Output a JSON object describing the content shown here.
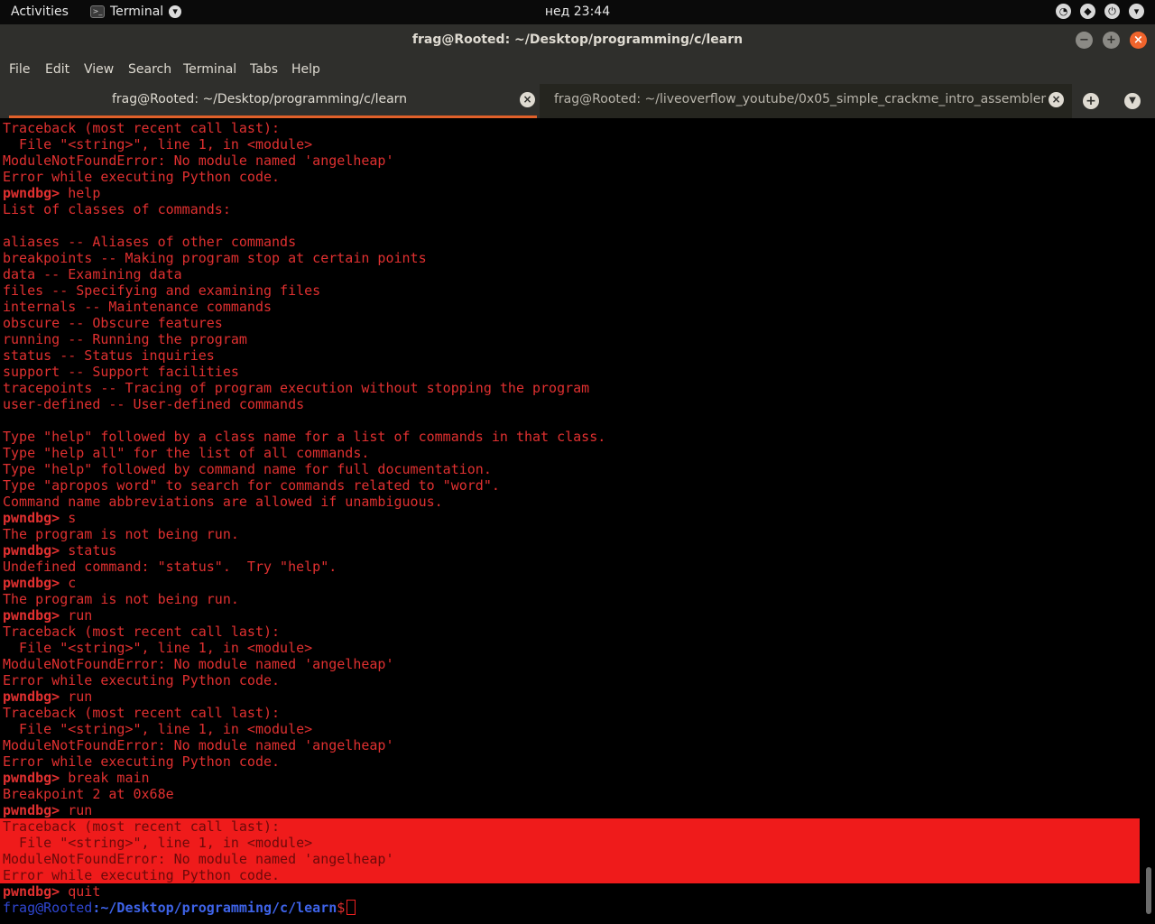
{
  "topbar": {
    "activities": "Activities",
    "app_name": "Terminal",
    "clock": "нед 23:44"
  },
  "window": {
    "title": "frag@Rooted: ~/Desktop/programming/c/learn"
  },
  "menu": [
    "File",
    "Edit",
    "View",
    "Search",
    "Terminal",
    "Tabs",
    "Help"
  ],
  "tabs": [
    {
      "label": "frag@Rooted: ~/Desktop/programming/c/learn"
    },
    {
      "label": "frag@Rooted: ~/liveoverflow_youtube/0x05_simple_crackme_intro_assembler"
    }
  ],
  "terminal": {
    "prompt": "pwndbg>",
    "lines": [
      {
        "t": "out",
        "text": "Traceback (most recent call last):"
      },
      {
        "t": "out",
        "text": "  File \"<string>\", line 1, in <module>"
      },
      {
        "t": "out",
        "text": "ModuleNotFoundError: No module named 'angelheap'"
      },
      {
        "t": "out",
        "text": "Error while executing Python code."
      },
      {
        "t": "cmd",
        "text": " help"
      },
      {
        "t": "out",
        "text": "List of classes of commands:"
      },
      {
        "t": "out",
        "text": ""
      },
      {
        "t": "out",
        "text": "aliases -- Aliases of other commands"
      },
      {
        "t": "out",
        "text": "breakpoints -- Making program stop at certain points"
      },
      {
        "t": "out",
        "text": "data -- Examining data"
      },
      {
        "t": "out",
        "text": "files -- Specifying and examining files"
      },
      {
        "t": "out",
        "text": "internals -- Maintenance commands"
      },
      {
        "t": "out",
        "text": "obscure -- Obscure features"
      },
      {
        "t": "out",
        "text": "running -- Running the program"
      },
      {
        "t": "out",
        "text": "status -- Status inquiries"
      },
      {
        "t": "out",
        "text": "support -- Support facilities"
      },
      {
        "t": "out",
        "text": "tracepoints -- Tracing of program execution without stopping the program"
      },
      {
        "t": "out",
        "text": "user-defined -- User-defined commands"
      },
      {
        "t": "out",
        "text": ""
      },
      {
        "t": "out",
        "text": "Type \"help\" followed by a class name for a list of commands in that class."
      },
      {
        "t": "out",
        "text": "Type \"help all\" for the list of all commands."
      },
      {
        "t": "out",
        "text": "Type \"help\" followed by command name for full documentation."
      },
      {
        "t": "out",
        "text": "Type \"apropos word\" to search for commands related to \"word\"."
      },
      {
        "t": "out",
        "text": "Command name abbreviations are allowed if unambiguous."
      },
      {
        "t": "cmd",
        "text": " s"
      },
      {
        "t": "out",
        "text": "The program is not being run."
      },
      {
        "t": "cmd",
        "text": " status"
      },
      {
        "t": "out",
        "text": "Undefined command: \"status\".  Try \"help\"."
      },
      {
        "t": "cmd",
        "text": " c"
      },
      {
        "t": "out",
        "text": "The program is not being run."
      },
      {
        "t": "cmd",
        "text": " run"
      },
      {
        "t": "out",
        "text": "Traceback (most recent call last):"
      },
      {
        "t": "out",
        "text": "  File \"<string>\", line 1, in <module>"
      },
      {
        "t": "out",
        "text": "ModuleNotFoundError: No module named 'angelheap'"
      },
      {
        "t": "out",
        "text": "Error while executing Python code."
      },
      {
        "t": "cmd",
        "text": " run"
      },
      {
        "t": "out",
        "text": "Traceback (most recent call last):"
      },
      {
        "t": "out",
        "text": "  File \"<string>\", line 1, in <module>"
      },
      {
        "t": "out",
        "text": "ModuleNotFoundError: No module named 'angelheap'"
      },
      {
        "t": "out",
        "text": "Error while executing Python code."
      },
      {
        "t": "cmd",
        "text": " break main"
      },
      {
        "t": "out",
        "text": "Breakpoint 2 at 0x68e"
      },
      {
        "t": "cmd",
        "text": " run"
      },
      {
        "t": "hl",
        "text": "Traceback (most recent call last):"
      },
      {
        "t": "hl",
        "text": "  File \"<string>\", line 1, in <module>"
      },
      {
        "t": "hl",
        "text": "ModuleNotFoundError: No module named 'angelheap'"
      },
      {
        "t": "hl",
        "text": "Error while executing Python code."
      },
      {
        "t": "cmd",
        "text": " quit"
      }
    ],
    "shell": {
      "user_host": "frag@Rooted",
      "colon": ":",
      "path": "~/Desktop/programming/c/learn",
      "symbol": "$"
    }
  },
  "colors": {
    "terminal_bg": "#000000",
    "terminal_text": "#e03030",
    "highlight_bg": "#ef1b1b",
    "accent": "#e0602a"
  }
}
